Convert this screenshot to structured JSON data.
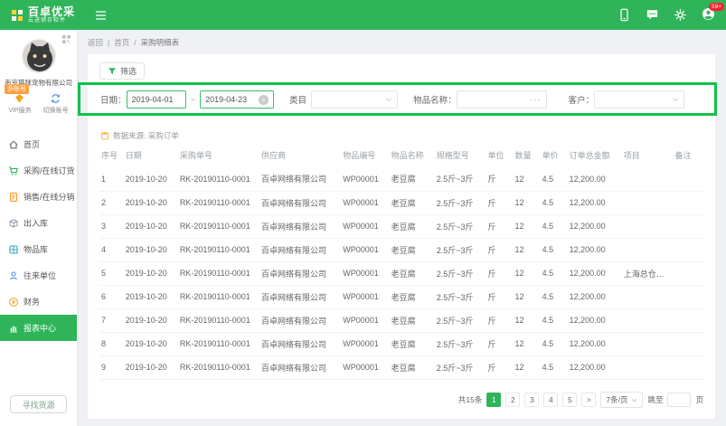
{
  "topbar": {
    "logo_title": "百卓优采",
    "logo_subtitle": "云进销存软件",
    "avatar_badge": "59+"
  },
  "sidebar": {
    "multi_account_tag": "多账号",
    "company_name": "南京猫咪宠物有限公司",
    "vip_service": "VIP服务",
    "switch_account": "切换账号",
    "menu": [
      {
        "label": "首页"
      },
      {
        "label": "采购/在线订货"
      },
      {
        "label": "销售/在线分销"
      },
      {
        "label": "出入库"
      },
      {
        "label": "物品库"
      },
      {
        "label": "往来单位"
      },
      {
        "label": "财务"
      },
      {
        "label": "报表中心"
      }
    ],
    "find_goods_button": "寻找货源"
  },
  "breadcrumb": {
    "back": "返回",
    "sep": "|",
    "home": "首页",
    "divider": "/",
    "current": "采购明细表"
  },
  "toolbar": {
    "filter_button": "筛选"
  },
  "filters": {
    "date_label": "日期：",
    "date_from": "2019-04-01",
    "date_tilde": "~",
    "date_to": "2019-04-23",
    "clear_icon": "×",
    "category_label": "类目",
    "item_name_label": "物品名称：",
    "item_name_more": "···",
    "customer_label": "客户："
  },
  "data_source_note": "数据来源: 采购订单",
  "table": {
    "headers": [
      "序号",
      "日期",
      "采购单号",
      "供应商",
      "物品编号",
      "物品名称",
      "规格型号",
      "单位",
      "数量",
      "单价",
      "订单总金额",
      "项目",
      "备注"
    ],
    "rows": [
      [
        "1",
        "2019-10-20",
        "RK-20190110-0001",
        "百卓网络有限公司",
        "WP00001",
        "老豆腐",
        "2.5斤~3斤",
        "斤",
        "12",
        "4.5",
        "12,200.00",
        "",
        ""
      ],
      [
        "2",
        "2019-10-20",
        "RK-20190110-0001",
        "百卓网络有限公司",
        "WP00001",
        "老豆腐",
        "2.5斤~3斤",
        "斤",
        "12",
        "4.5",
        "12,200.00",
        "",
        ""
      ],
      [
        "3",
        "2019-10-20",
        "RK-20190110-0001",
        "百卓网络有限公司",
        "WP00001",
        "老豆腐",
        "2.5斤~3斤",
        "斤",
        "12",
        "4.5",
        "12,200.00",
        "",
        ""
      ],
      [
        "4",
        "2019-10-20",
        "RK-20190110-0001",
        "百卓网络有限公司",
        "WP00001",
        "老豆腐",
        "2.5斤~3斤",
        "斤",
        "12",
        "4.5",
        "12,200.00",
        "",
        ""
      ],
      [
        "5",
        "2019-10-20",
        "RK-20190110-0001",
        "百卓网络有限公司",
        "WP00001",
        "老豆腐",
        "2.5斤~3斤",
        "斤",
        "12",
        "4.5",
        "12,200.00",
        "上海总仓数的项...",
        ""
      ],
      [
        "6",
        "2019-10-20",
        "RK-20190110-0001",
        "百卓网络有限公司",
        "WP00001",
        "老豆腐",
        "2.5斤~3斤",
        "斤",
        "12",
        "4.5",
        "12,200.00",
        "",
        ""
      ],
      [
        "7",
        "2019-10-20",
        "RK-20190110-0001",
        "百卓网络有限公司",
        "WP00001",
        "老豆腐",
        "2.5斤~3斤",
        "斤",
        "12",
        "4.5",
        "12,200.00",
        "",
        ""
      ],
      [
        "8",
        "2019-10-20",
        "RK-20190110-0001",
        "百卓网络有限公司",
        "WP00001",
        "老豆腐",
        "2.5斤~3斤",
        "斤",
        "12",
        "4.5",
        "12,200.00",
        "",
        ""
      ],
      [
        "9",
        "2019-10-20",
        "RK-20190110-0001",
        "百卓网络有限公司",
        "WP00001",
        "老豆腐",
        "2.5斤~3斤",
        "斤",
        "12",
        "4.5",
        "12,200.00",
        "",
        ""
      ]
    ]
  },
  "pagination": {
    "total": "共15条",
    "pages": [
      "1",
      "2",
      "3",
      "4",
      "5"
    ],
    "active_page": "1",
    "next": ">",
    "page_size": "7条/页",
    "jump_label": "跳至",
    "jump_unit": "页"
  }
}
